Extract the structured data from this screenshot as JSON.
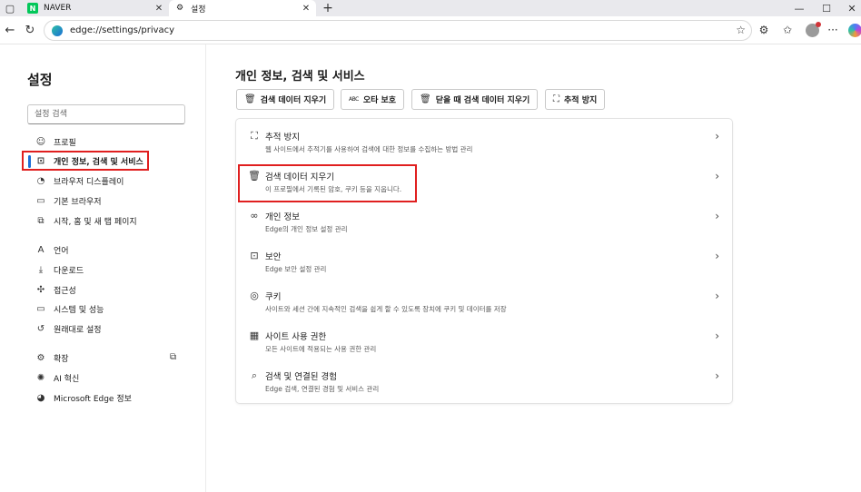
{
  "tabs": [
    {
      "title": "NAVER",
      "favicon": "naver-icon",
      "favicon_text": "N"
    },
    {
      "title": "설정",
      "favicon": "gear-icon"
    }
  ],
  "address_bar": {
    "url": "edge://settings/privacy"
  },
  "sidebar": {
    "title": "설정",
    "search_placeholder": "설정 검색",
    "groups": [
      [
        {
          "label": "프로필",
          "icon": "profile-icon"
        },
        {
          "label": "개인 정보, 검색 및 서비스",
          "icon": "lock-icon",
          "active": true
        },
        {
          "label": "브라우저 디스플레이",
          "icon": "palette-icon"
        },
        {
          "label": "기본 브라우저",
          "icon": "browser-icon"
        },
        {
          "label": "시작, 홈 및 새 탭 페이지",
          "icon": "home-tab-icon"
        }
      ],
      [
        {
          "label": "언어",
          "icon": "language-icon"
        },
        {
          "label": "다운로드",
          "icon": "download-icon"
        },
        {
          "label": "접근성",
          "icon": "accessibility-icon"
        },
        {
          "label": "시스템 및 성능",
          "icon": "system-icon"
        },
        {
          "label": "원래대로 설정",
          "icon": "reset-icon"
        }
      ],
      [
        {
          "label": "확장",
          "icon": "extensions-icon"
        },
        {
          "label": "AI 혁신",
          "icon": "ai-icon"
        },
        {
          "label": "Microsoft Edge 정보",
          "icon": "edge-icon"
        }
      ]
    ]
  },
  "main": {
    "title": "개인 정보, 검색 및 서비스",
    "quick_actions": [
      {
        "label": "검색 데이터 지우기",
        "icon": "trash-icon"
      },
      {
        "label": "오타 보호",
        "icon": "abc-check-icon",
        "icon_text": "ABC"
      },
      {
        "label": "닫을 때 검색 데이터 지우기",
        "icon": "trash-clock-icon"
      },
      {
        "label": "추적 방지",
        "icon": "tracking-icon"
      }
    ],
    "rows": [
      {
        "label": "추적 방지",
        "desc": "웹 사이트에서 추적기를 사용하여 검색에 대한 정보를 수집하는 방법 관리",
        "icon": "tracking-icon"
      },
      {
        "label": "검색 데이터 지우기",
        "desc": "이 프로필에서 기록된 암호, 쿠키 등을 지웁니다.",
        "icon": "trash-icon"
      },
      {
        "label": "개인 정보",
        "desc": "Edge의 개인 정보 설정 관리",
        "icon": "glasses-icon"
      },
      {
        "label": "보안",
        "desc": "Edge 보안 설정 관리",
        "icon": "lock-icon"
      },
      {
        "label": "쿠키",
        "desc": "사이트와 세션 간에 지속적인 검색을 쉽게 할 수 있도록 장치에 쿠키 및 데이터를 저장",
        "icon": "cookie-icon"
      },
      {
        "label": "사이트 사용 권한",
        "desc": "모든 사이트에 적용되는 사용 권한 관리",
        "icon": "site-permissions-icon"
      },
      {
        "label": "검색 및 연결된 경험",
        "desc": "Edge 검색, 연결된 경험 및 서비스 관리",
        "icon": "search-icon"
      }
    ]
  }
}
